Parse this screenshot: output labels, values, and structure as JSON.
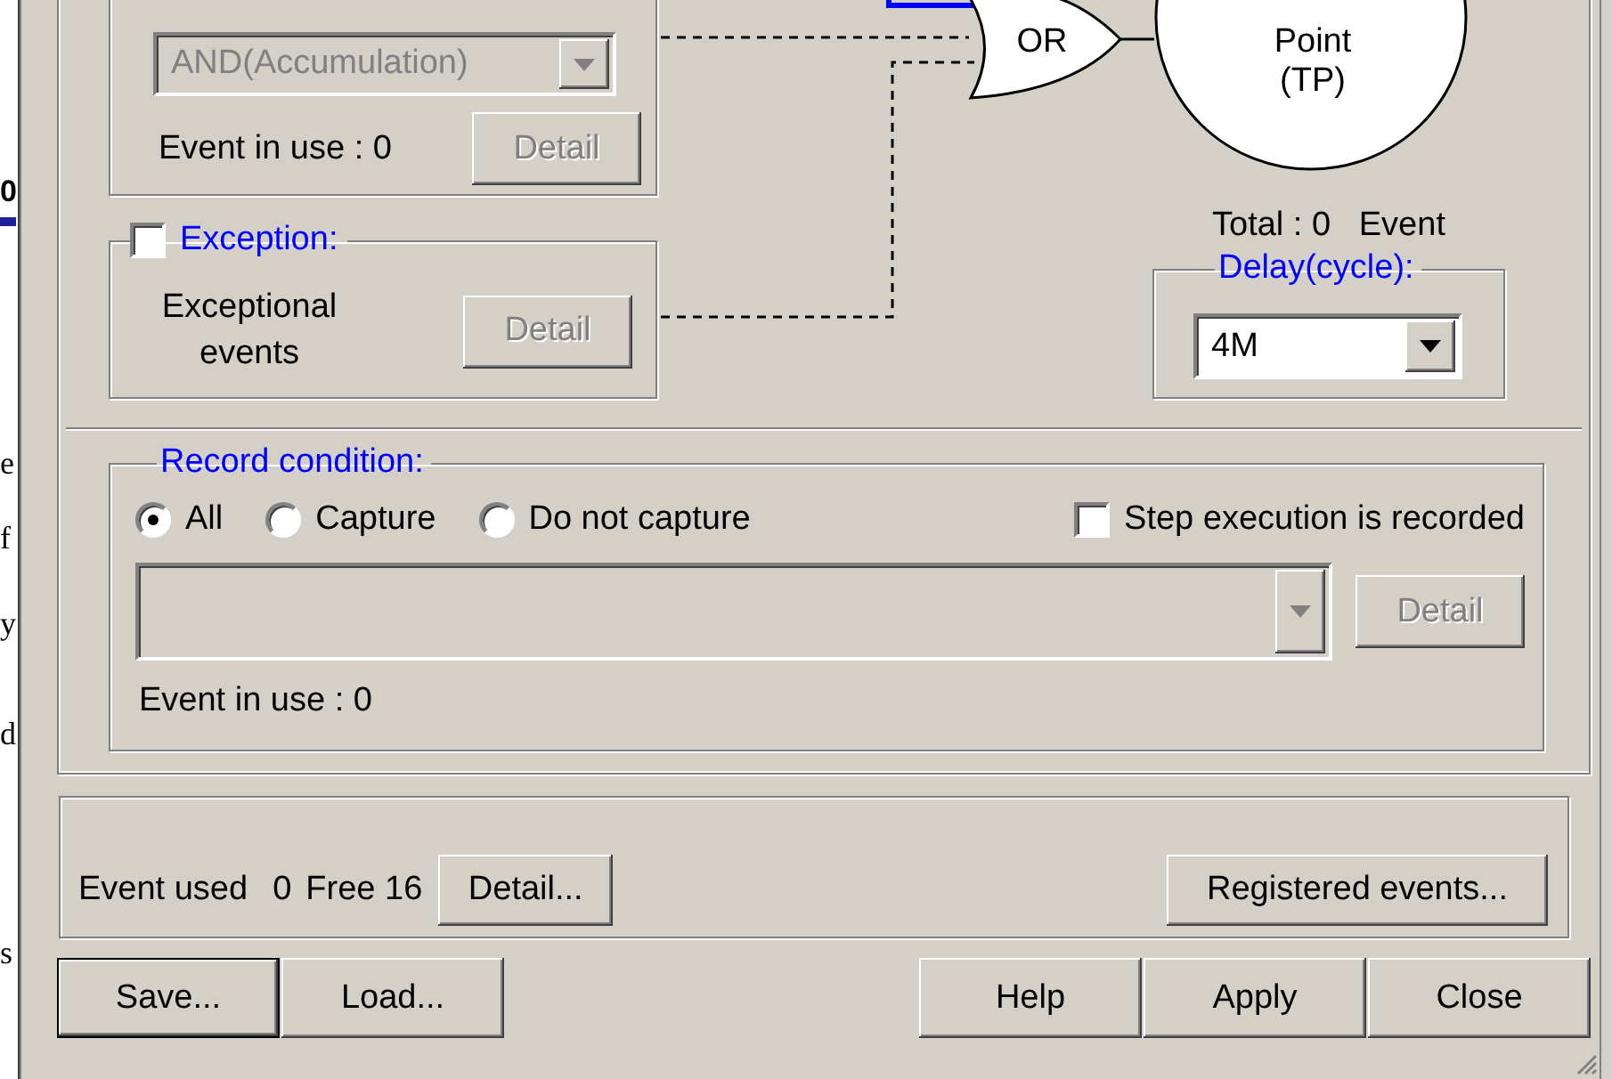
{
  "background_page": {
    "heading": "0",
    "letters": [
      "e",
      "f",
      "y",
      "d",
      "s"
    ]
  },
  "other_conditions": {
    "combo": {
      "value": "AND(Accumulation)",
      "disabled": true
    },
    "event_in_use": "Event in use : 0",
    "detail": {
      "label": "Detail",
      "disabled": true
    }
  },
  "exception": {
    "label": "Exception:",
    "checked": false,
    "description": "Exceptional events",
    "detail": {
      "label": "Detail",
      "disabled": true
    }
  },
  "diagram": {
    "gate": "OR",
    "trace_point": [
      "Point",
      "(TP)"
    ]
  },
  "total": "Total : 0   Event",
  "delay": {
    "label": "Delay(cycle):",
    "combo": {
      "value": "4M",
      "disabled": false
    }
  },
  "record_condition": {
    "label": "Record condition:",
    "options": [
      {
        "label": "All",
        "selected": true
      },
      {
        "label": "Capture",
        "selected": false
      },
      {
        "label": "Do not capture",
        "selected": false
      }
    ],
    "step_recorded": {
      "label": "Step execution is recorded",
      "checked": false
    },
    "combo": {
      "disabled": true
    },
    "detail": {
      "label": "Detail",
      "disabled": true
    },
    "event_in_use": "Event in use : 0"
  },
  "events": {
    "used_label": "Event used",
    "used_value": "0",
    "free": "Free 16",
    "detail": {
      "label": "Detail...",
      "disabled": false
    },
    "registered": {
      "label": "Registered events...",
      "disabled": false
    }
  },
  "buttons_left": [
    {
      "label": "Save...",
      "default": true
    },
    {
      "label": "Load...",
      "default": false
    }
  ],
  "buttons_right": [
    {
      "label": "Help",
      "default": false
    },
    {
      "label": "Apply",
      "default": false
    },
    {
      "label": "Close",
      "default": false
    }
  ]
}
